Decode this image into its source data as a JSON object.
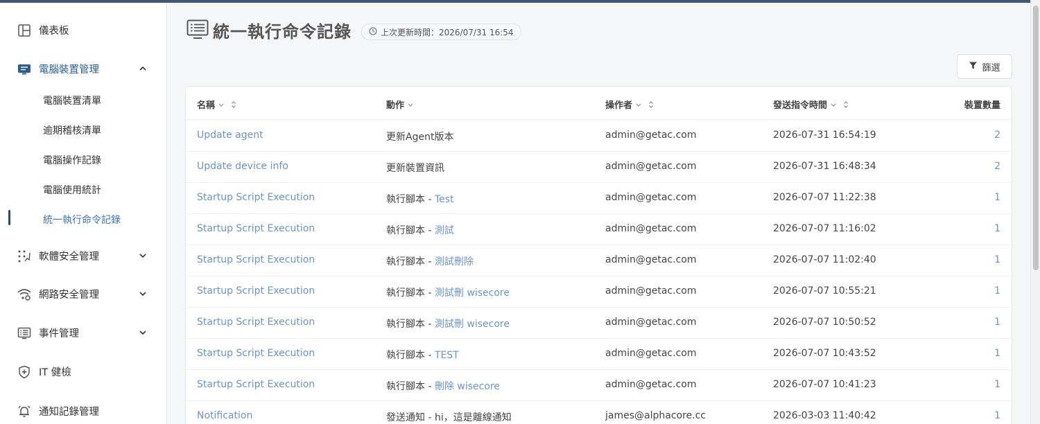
{
  "sidebar": {
    "items": [
      {
        "label": "儀表板",
        "icon": "layout-icon"
      },
      {
        "label": "電腦裝置管理",
        "icon": "computer-icon",
        "expanded": true
      },
      {
        "label": "軟體安全管理",
        "icon": "dots-grid-icon"
      },
      {
        "label": "網路安全管理",
        "icon": "wifi-gear-icon"
      },
      {
        "label": "事件管理",
        "icon": "list-icon"
      },
      {
        "label": "IT 健檢",
        "icon": "shield-plus-icon"
      },
      {
        "label": "通知記錄管理",
        "icon": "bell-icon"
      }
    ],
    "subitems": [
      {
        "label": "電腦裝置清單"
      },
      {
        "label": "逾期稽核清單"
      },
      {
        "label": "電腦操作記錄"
      },
      {
        "label": "電腦使用統計"
      },
      {
        "label": "統一執行命令記錄",
        "active": true
      }
    ]
  },
  "header": {
    "title": "統一執行命令記錄",
    "updated_label": "上次更新時間：2026/07/31 16:54"
  },
  "toolbar": {
    "filter_label": "篩選"
  },
  "table": {
    "columns": [
      {
        "label": "名稱"
      },
      {
        "label": "動作"
      },
      {
        "label": "操作者"
      },
      {
        "label": "發送指令時間"
      },
      {
        "label": "裝置數量"
      }
    ],
    "rows": [
      {
        "name": "Update agent",
        "action": "更新Agent版本",
        "target": "",
        "operator": "admin@getac.com",
        "time": "2026-07-31 16:54:19",
        "count": "2"
      },
      {
        "name": "Update device info",
        "action": "更新裝置資訊",
        "target": "",
        "operator": "admin@getac.com",
        "time": "2026-07-31 16:48:34",
        "count": "2"
      },
      {
        "name": "Startup Script Execution",
        "action": "執行腳本 - ",
        "target": "Test",
        "operator": "admin@getac.com",
        "time": "2026-07-07 11:22:38",
        "count": "1"
      },
      {
        "name": "Startup Script Execution",
        "action": "執行腳本 - ",
        "target": "測試",
        "operator": "admin@getac.com",
        "time": "2026-07-07 11:16:02",
        "count": "1"
      },
      {
        "name": "Startup Script Execution",
        "action": "執行腳本 - ",
        "target": "測試刪除",
        "operator": "admin@getac.com",
        "time": "2026-07-07 11:02:40",
        "count": "1"
      },
      {
        "name": "Startup Script Execution",
        "action": "執行腳本 - ",
        "target": "測試刪 wisecore",
        "operator": "admin@getac.com",
        "time": "2026-07-07 10:55:21",
        "count": "1"
      },
      {
        "name": "Startup Script Execution",
        "action": "執行腳本 - ",
        "target": "測試刪 wisecore",
        "operator": "admin@getac.com",
        "time": "2026-07-07 10:50:52",
        "count": "1"
      },
      {
        "name": "Startup Script Execution",
        "action": "執行腳本 - ",
        "target": "TEST",
        "operator": "admin@getac.com",
        "time": "2026-07-07 10:43:52",
        "count": "1"
      },
      {
        "name": "Startup Script Execution",
        "action": "執行腳本 - ",
        "target": "刪除 wisecore",
        "operator": "admin@getac.com",
        "time": "2026-07-07 10:41:23",
        "count": "1"
      },
      {
        "name": "Notification",
        "action": "發送通知 - hi，這是離線通知",
        "target": "",
        "operator": "james@alphacore.cc",
        "time": "2026-03-03 11:40:42",
        "count": "1"
      }
    ]
  },
  "colors": {
    "accent": "#2f5d8a",
    "link": "#6d93bf",
    "topbar": "#3f5873"
  }
}
